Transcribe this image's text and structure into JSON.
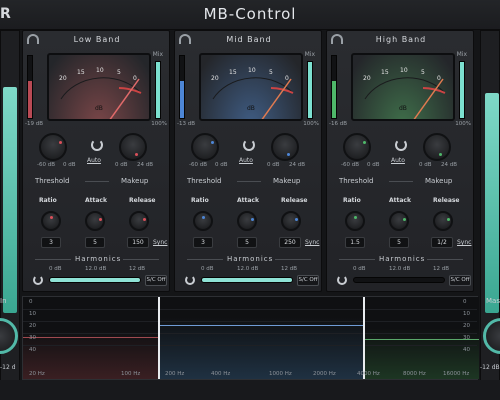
{
  "app": {
    "title": "MB-Control",
    "logo_fragment": "R"
  },
  "left_panel": {
    "in_label": "In",
    "value": "-12 d",
    "bottom": "x"
  },
  "right_panel": {
    "label": "Mas",
    "value": "-12 dB",
    "button": "Au"
  },
  "bands": [
    {
      "title": "Low Band",
      "mix_label": "Mix",
      "vu_scale": [
        "20",
        "15",
        "10",
        "5",
        "0"
      ],
      "vu_unit": "dB",
      "meter_bottom": "-19 dB",
      "mix_bottom": "100%",
      "threshold_range": [
        "-60 dB",
        "0 dB"
      ],
      "makeup_range": [
        "0 dB",
        "24 dB"
      ],
      "auto": "Auto",
      "threshold": "Threshold",
      "makeup": "Makeup",
      "ratio": "Ratio",
      "attack": "Attack",
      "release": "Release",
      "ratio_value": "3",
      "attack_value": "5",
      "release_value": "150",
      "sync": "Sync",
      "harmonics": "Harmonics",
      "harm_scale": [
        "0 dB",
        "12.0 dB",
        "12 dB"
      ],
      "sc": "S/C Off",
      "harm_fraction": 1.0,
      "accent": "#d9505a",
      "vu_bg": "#7a4648"
    },
    {
      "title": "Mid Band",
      "mix_label": "Mix",
      "vu_scale": [
        "20",
        "15",
        "10",
        "5",
        "0"
      ],
      "vu_unit": "dB",
      "meter_bottom": "-13 dB",
      "mix_bottom": "100%",
      "threshold_range": [
        "-60 dB",
        "0 dB"
      ],
      "makeup_range": [
        "0 dB",
        "24 dB"
      ],
      "auto": "Auto",
      "threshold": "Threshold",
      "makeup": "Makeup",
      "ratio": "Ratio",
      "attack": "Attack",
      "release": "Release",
      "ratio_value": "3",
      "attack_value": "5",
      "release_value": "250",
      "sync": "Sync",
      "harmonics": "Harmonics",
      "harm_scale": [
        "0 dB",
        "12.0 dB",
        "12 dB"
      ],
      "sc": "S/C Off",
      "harm_fraction": 1.0,
      "accent": "#4d86d6",
      "vu_bg": "#3f5c83"
    },
    {
      "title": "High Band",
      "mix_label": "Mix",
      "vu_scale": [
        "20",
        "15",
        "10",
        "5",
        "0"
      ],
      "vu_unit": "dB",
      "meter_bottom": "-16 dB",
      "mix_bottom": "100%",
      "threshold_range": [
        "-60 dB",
        "0 dB"
      ],
      "makeup_range": [
        "0 dB",
        "24 dB"
      ],
      "auto": "Auto",
      "threshold": "Threshold",
      "makeup": "Makeup",
      "ratio": "Ratio",
      "attack": "Attack",
      "release": "Release",
      "ratio_value": "1.5",
      "attack_value": "5",
      "release_value": "1/2",
      "sync": "Sync",
      "harmonics": "Harmonics",
      "harm_scale": [
        "0 dB",
        "12.0 dB",
        "12 dB"
      ],
      "sc": "S/C Off",
      "harm_fraction": 0.0,
      "accent": "#4fb86a",
      "vu_bg": "#3f6e4a"
    }
  ],
  "spectrum": {
    "db_labels": [
      "0",
      "10",
      "20",
      "30",
      "40"
    ],
    "hz_labels": [
      "20 Hz",
      "100 Hz",
      "200 Hz",
      "400 Hz",
      "1000 Hz",
      "2000 Hz",
      "4000 Hz",
      "8000 Hz",
      "16000 Hz"
    ]
  }
}
